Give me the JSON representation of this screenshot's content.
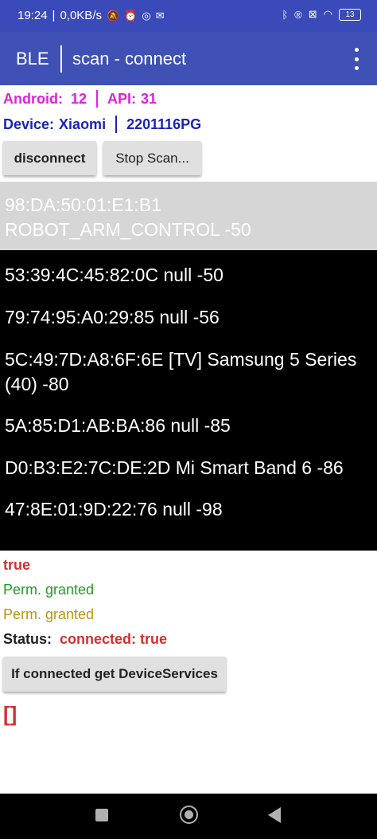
{
  "status_bar": {
    "time": "19:24",
    "net_speed": "0,0KB/s",
    "battery": "13",
    "colors": {
      "bg": "#3a4ab8"
    }
  },
  "app_bar": {
    "title": "BLE",
    "subtitle": "scan - connect",
    "overflow_icon": "more-vert-icon"
  },
  "info": {
    "android_label": "Android:",
    "android_version": "12",
    "api_label": "API:",
    "api_value": "31",
    "device_label": "Device:",
    "device_brand": "Xiaomi",
    "device_model": "2201116PG"
  },
  "buttons": {
    "disconnect": "disconnect",
    "stop_scan": "Stop Scan...",
    "get_services": "If connected get DeviceServices"
  },
  "devices": [
    "98:DA:50:01:E1:B1 ROBOT_ARM_CONTROL -50",
    "53:39:4C:45:82:0C null -50",
    "79:74:95:A0:29:85 null -56",
    "5C:49:7D:A8:6F:6E [TV] Samsung 5 Series (40) -80",
    "5A:85:D1:AB:BA:86 null -85",
    "D0:B3:E2:7C:DE:2D Mi Smart Band 6 -86",
    "47:8E:01:9D:22:76 null -98"
  ],
  "result": {
    "flag": "true",
    "perm_1": "Perm. granted",
    "perm_2": "Perm. granted",
    "status_label": "Status:",
    "status_value": "connected: true",
    "services_output": "[]"
  },
  "colors": {
    "primary": "#3f51b5",
    "magenta": "#e020e0",
    "blue": "#1a24b8",
    "red": "#d32f2f",
    "green": "#1e9e1e",
    "gold": "#b8960c"
  }
}
